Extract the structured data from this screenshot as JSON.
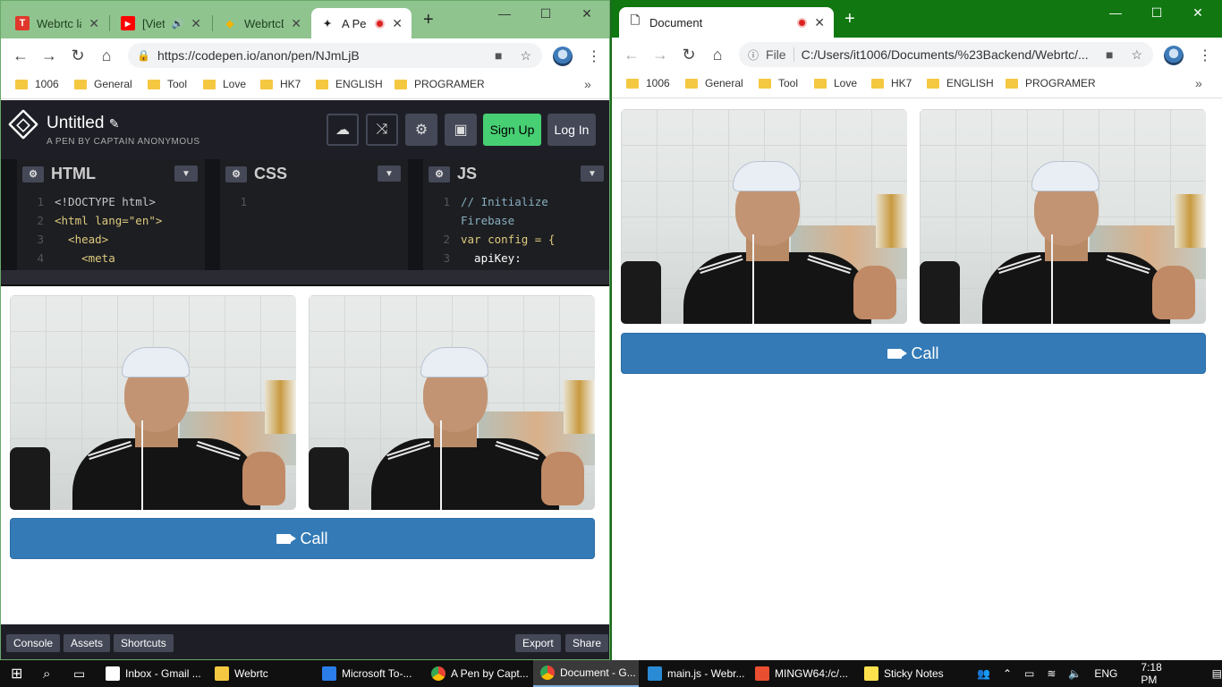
{
  "left_window": {
    "tabs": [
      {
        "title": "Webrtc lả",
        "favicon": "T",
        "favicon_color": "#e0392b"
      },
      {
        "title": "[Viet",
        "favicon": "▶",
        "favicon_color": "#ff0000"
      },
      {
        "title": "WebrtcD",
        "favicon": "◆",
        "favicon_color": "#f4b400"
      },
      {
        "title": "A Pe",
        "favicon": "✦",
        "favicon_color": "#222222"
      }
    ],
    "url": "https://codepen.io/anon/pen/NJmLjB",
    "bookmarks": [
      "1006",
      "General",
      "Tool",
      "Love",
      "HK7",
      "ENGLISH",
      "PROGRAMER"
    ],
    "codepen": {
      "title": "Untitled",
      "subtitle": "A PEN BY CAPTAIN ANONYMOUS",
      "sign_up": "Sign Up",
      "log_in": "Log In",
      "panels": {
        "html": {
          "label": "HTML",
          "lines": [
            {
              "n": "1",
              "text": "<!DOCTYPE html>"
            },
            {
              "n": "2",
              "text": "<html lang=\"en\">"
            },
            {
              "n": "3",
              "text": "  <head>"
            },
            {
              "n": "4",
              "text": "    <meta"
            }
          ]
        },
        "css": {
          "label": "CSS",
          "lines": [
            {
              "n": "1",
              "text": ""
            }
          ]
        },
        "js": {
          "label": "JS",
          "lines": [
            {
              "n": "1",
              "text": "// Initialize"
            },
            {
              "n": "",
              "text": "Firebase"
            },
            {
              "n": "2",
              "text": "var config = {"
            },
            {
              "n": "3",
              "text": "  apiKey:"
            }
          ]
        }
      },
      "footer": {
        "console": "Console",
        "assets": "Assets",
        "shortcuts": "Shortcuts",
        "export": "Export",
        "share": "Share"
      }
    },
    "call_label": "Call"
  },
  "right_window": {
    "tab_title": "Document",
    "url_prefix": "File",
    "url": "C:/Users/it1006/Documents/%23Backend/Webrtc/...",
    "bookmarks": [
      "1006",
      "General",
      "Tool",
      "Love",
      "HK7",
      "ENGLISH",
      "PROGRAMER"
    ],
    "call_label": "Call"
  },
  "taskbar": {
    "items": [
      "Inbox - Gmail ...",
      "Webrtc",
      "Microsoft To-...",
      "A Pen by Capt...",
      "Document - G...",
      "main.js - Webr...",
      "MINGW64:/c/...",
      "Sticky Notes"
    ],
    "language": "ENG",
    "time": "7:18 PM"
  },
  "colors": {
    "call_button": "#337ab7",
    "signup": "#47cf73",
    "codepen_bg": "#1e1f26"
  }
}
